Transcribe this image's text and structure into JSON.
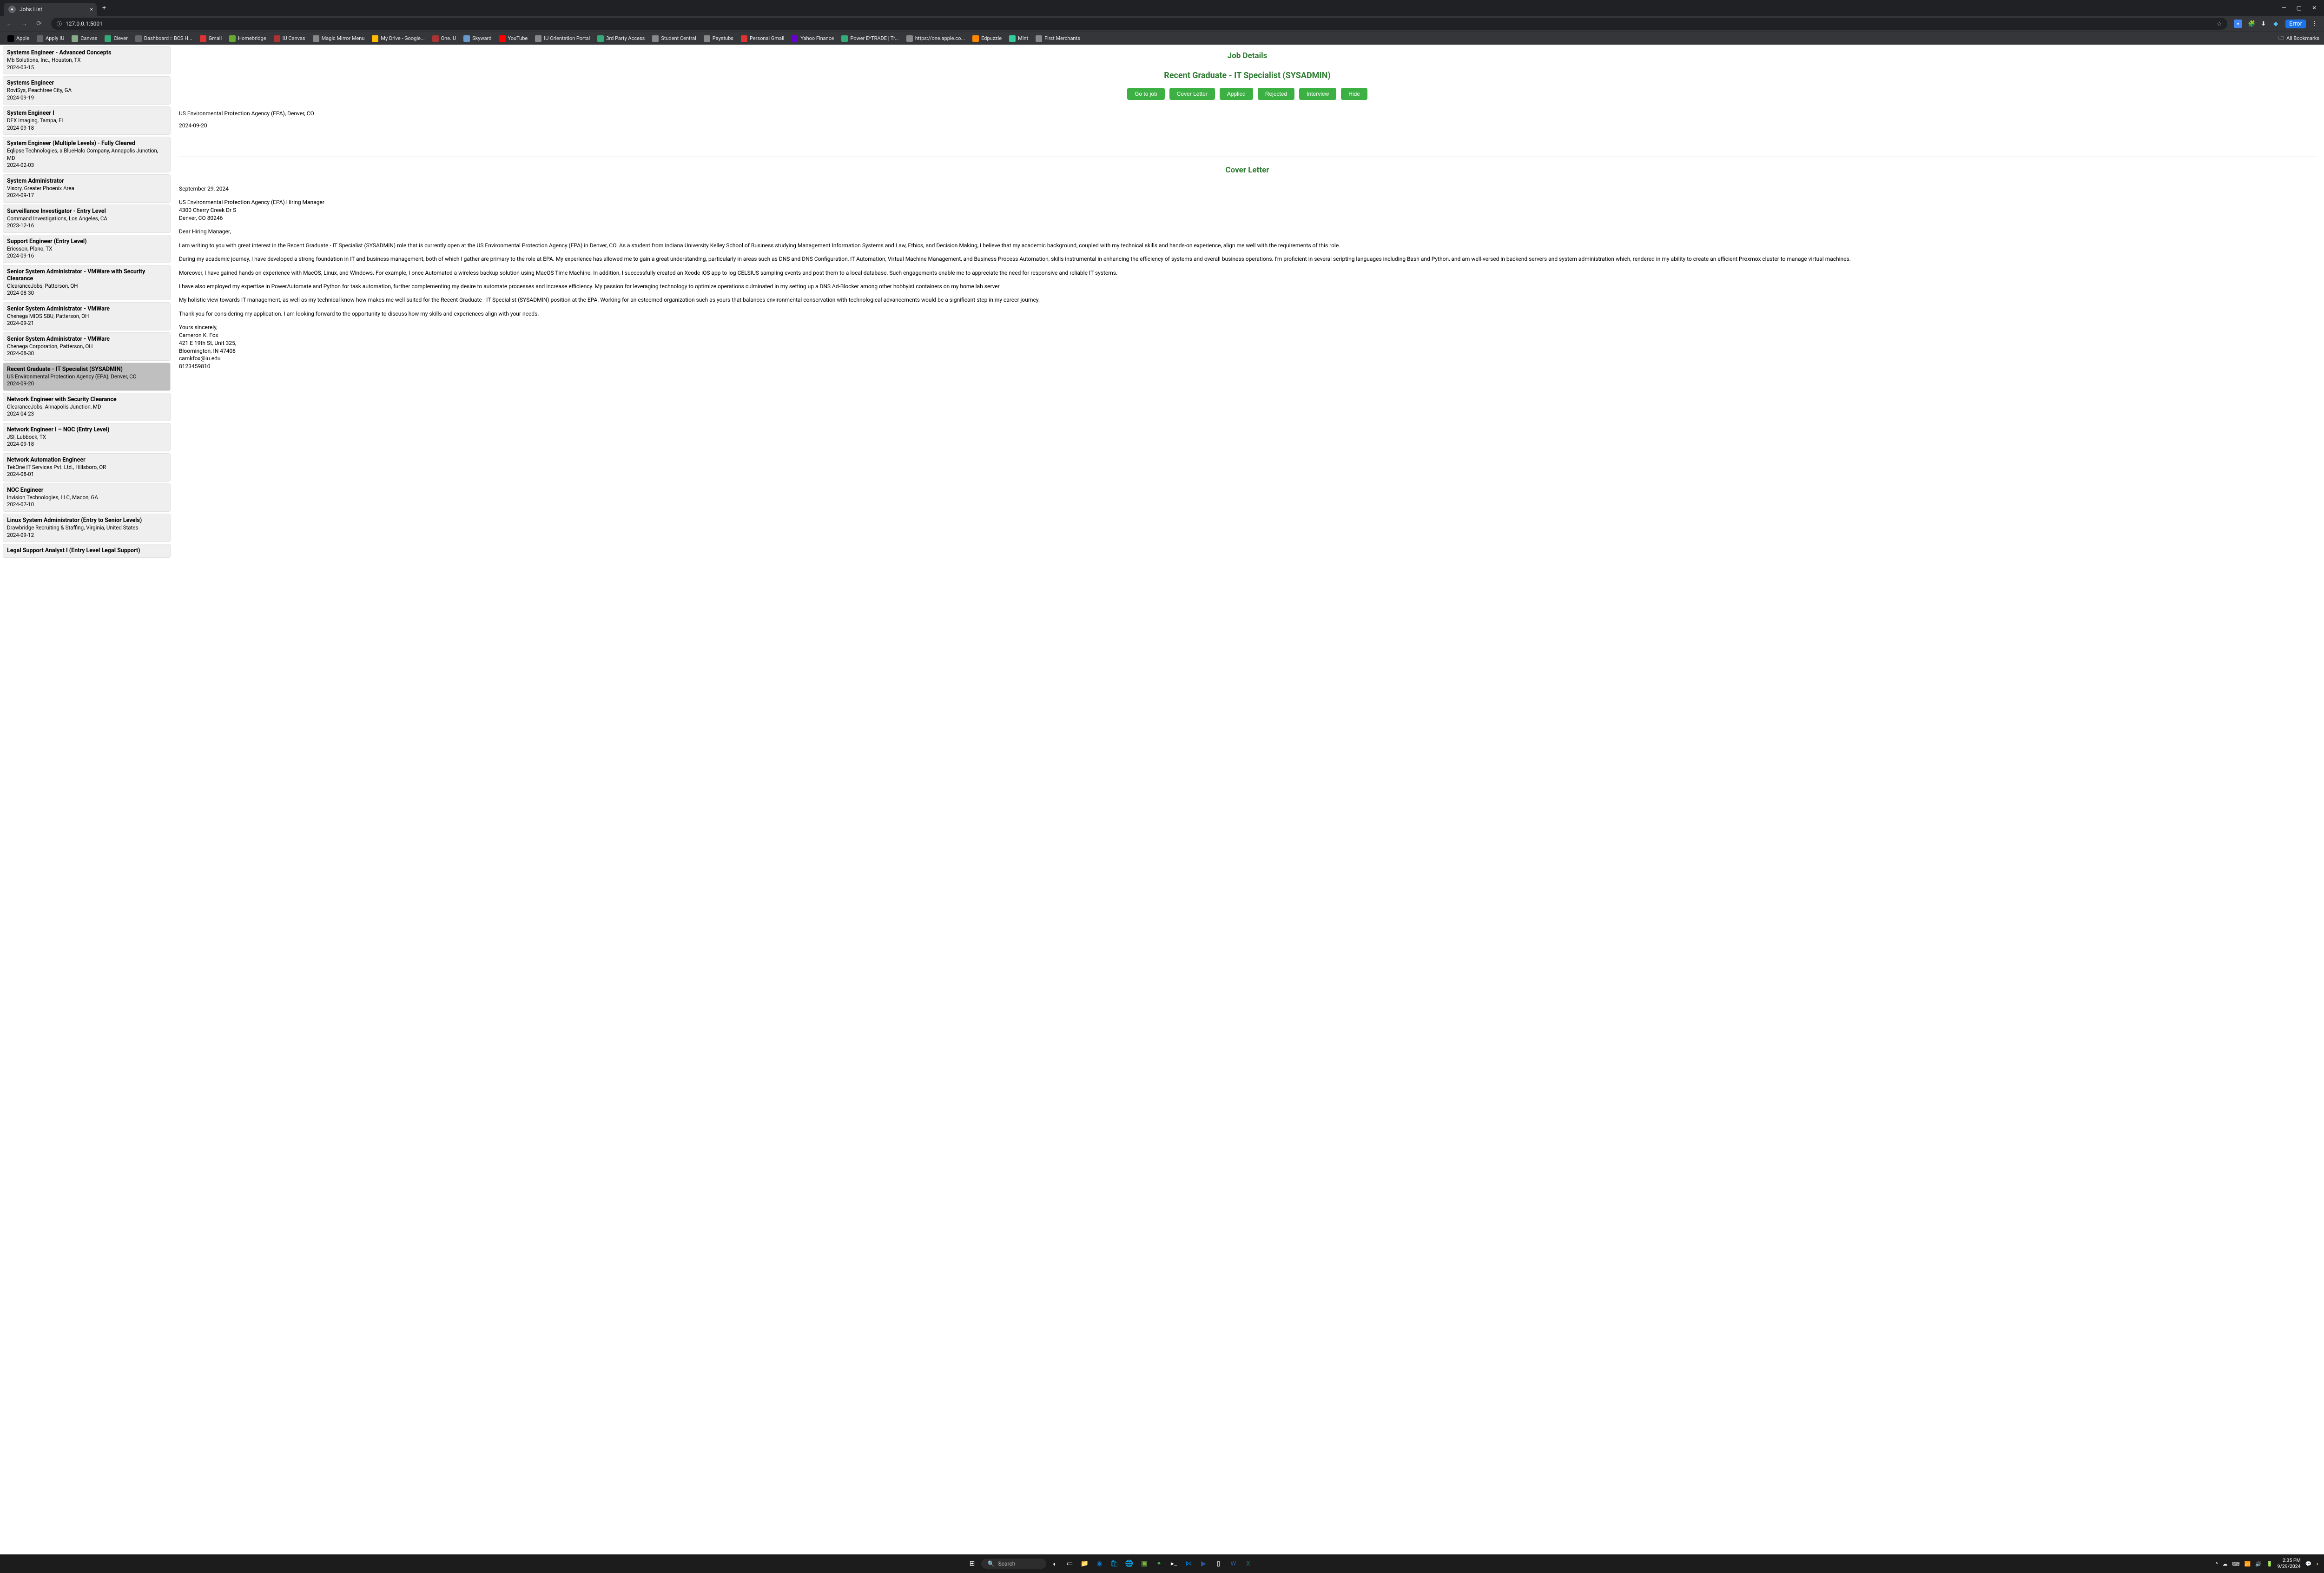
{
  "browser": {
    "tab_title": "Jobs List",
    "url": "127.0.0.1:5001",
    "profile_label": "Error",
    "all_bookmarks": "All Bookmarks"
  },
  "bookmarks": [
    {
      "label": "Apple",
      "color": "#000"
    },
    {
      "label": "Apply IU",
      "color": "#666"
    },
    {
      "label": "Canvas",
      "color": "#8a8"
    },
    {
      "label": "Clever",
      "color": "#3a7"
    },
    {
      "label": "Dashboard :: BCS H...",
      "color": "#666"
    },
    {
      "label": "Gmail",
      "color": "#d33"
    },
    {
      "label": "Homebridge",
      "color": "#6a3"
    },
    {
      "label": "IU Canvas",
      "color": "#a33"
    },
    {
      "label": "Magic Mirror Menu",
      "color": "#888"
    },
    {
      "label": "My Drive - Google...",
      "color": "#fb0"
    },
    {
      "label": "One.IU",
      "color": "#a33"
    },
    {
      "label": "Skyward",
      "color": "#69c"
    },
    {
      "label": "YouTube",
      "color": "#f00"
    },
    {
      "label": "IU Orientation Portal",
      "color": "#888"
    },
    {
      "label": "3rd Party Access",
      "color": "#3a7"
    },
    {
      "label": "Student Central",
      "color": "#888"
    },
    {
      "label": "Paystubs",
      "color": "#888"
    },
    {
      "label": "Personal Gmail",
      "color": "#d33"
    },
    {
      "label": "Yahoo Finance",
      "color": "#60c"
    },
    {
      "label": "Power E*TRADE | Tr...",
      "color": "#3a7"
    },
    {
      "label": "https://one.apple.co...",
      "color": "#888"
    },
    {
      "label": "Edpuzzle",
      "color": "#f80"
    },
    {
      "label": "Mint",
      "color": "#3c9"
    },
    {
      "label": "First Merchants",
      "color": "#888"
    }
  ],
  "jobs": [
    {
      "title": "Systems Engineer - Advanced Concepts",
      "company": "Mb Solutions, Inc., Houston, TX",
      "date": "2024-03-15"
    },
    {
      "title": "Systems Engineer",
      "company": "RoviSys, Peachtree City, GA",
      "date": "2024-09-19"
    },
    {
      "title": "System Engineer I",
      "company": "DEX Imaging, Tampa, FL",
      "date": "2024-09-18"
    },
    {
      "title": "System Engineer (Multiple Levels) - Fully Cleared",
      "company": "Eqlipse Technologies, a BlueHalo Company, Annapolis Junction, MD",
      "date": "2024-02-03"
    },
    {
      "title": "System Administrator",
      "company": "Visory, Greater Phoenix Area",
      "date": "2024-09-17"
    },
    {
      "title": "Surveillance Investigator - Entry Level",
      "company": "Command Investigations, Los Angeles, CA",
      "date": "2023-12-16"
    },
    {
      "title": "Support Engineer (Entry Level)",
      "company": "Ericsson, Plano, TX",
      "date": "2024-09-16"
    },
    {
      "title": "Senior System Administrator - VMWare with Security Clearance",
      "company": "ClearanceJobs, Patterson, OH",
      "date": "2024-08-30"
    },
    {
      "title": "Senior System Administrator - VMWare",
      "company": "Chenega MIOS SBU, Patterson, OH",
      "date": "2024-09-21"
    },
    {
      "title": "Senior System Administrator - VMWare",
      "company": "Chenega Corporation, Patterson, OH",
      "date": "2024-08-30"
    },
    {
      "title": "Recent Graduate - IT Specialist (SYSADMIN)",
      "company": "US Environmental Protection Agency (EPA), Denver, CO",
      "date": "2024-09-20",
      "selected": true
    },
    {
      "title": "Network Engineer with Security Clearance",
      "company": "ClearanceJobs, Annapolis Junction, MD",
      "date": "2024-04-23"
    },
    {
      "title": "Network Engineer I – NOC (Entry Level)",
      "company": "JSI, Lubbock, TX",
      "date": "2024-09-18"
    },
    {
      "title": "Network Automation Engineer",
      "company": "TekOne IT Services Pvt. Ltd., Hillsboro, OR",
      "date": "2024-08-01"
    },
    {
      "title": "NOC Engineer",
      "company": "Invision Technologies, LLC, Macon, GA",
      "date": "2024-07-10"
    },
    {
      "title": "Linux System Administrator (Entry to Senior Levels)",
      "company": "Drawbridge Recruiting & Staffing, Virginia, United States",
      "date": "2024-09-12"
    },
    {
      "title": "Legal Support Analyst I (Entry Level Legal Support)",
      "company": "",
      "date": ""
    }
  ],
  "detail": {
    "heading": "Job Details",
    "title": "Recent Graduate - IT Specialist (SYSADMIN)",
    "actions": {
      "go_to_job": "Go to job",
      "cover_letter": "Cover Letter",
      "applied": "Applied",
      "rejected": "Rejected",
      "interview": "Interview",
      "hide": "Hide"
    },
    "company_loc": "US Environmental Protection Agency (EPA), Denver, CO",
    "date": "2024-09-20"
  },
  "cover": {
    "heading": "Cover Letter",
    "date": "September 29, 2024",
    "addr1": "US Environmental Protection Agency (EPA) Hiring Manager",
    "addr2": "4300 Cherry Creek Dr S",
    "addr3": "Denver, CO 80246",
    "greeting": "Dear Hiring Manager,",
    "p1": "I am writing to you with great interest in the Recent Graduate - IT Specialist (SYSADMIN) role that is currently open at the US Environmental Protection Agency (EPA) in Denver, CO. As a student from Indiana University Kelley School of Business studying Management Information Systems and Law, Ethics, and Decision Making, I believe that my academic background, coupled with my technical skills and hands-on experience, align me well with the requirements of this role.",
    "p2": "During my academic journey, I have developed a strong foundation in IT and business management, both of which I gather are primary to the role at EPA. My experience has allowed me to gain a great understanding, particularly in areas such as DNS and DNS Configuration, IT Automation, Virtual Machine Management, and Business Process Automation, skills instrumental in enhancing the efficiency of systems and overall business operations. I'm proficient in several scripting languages including Bash and Python, and am well-versed in backend servers and system administration which, rendered in my ability to create an efficient Proxmox cluster to manage virtual machines.",
    "p3": "Moreover, I have gained hands on experience with MacOS, Linux, and Windows. For example, I once Automated a wireless backup solution using MacOS Time Machine. In addition, I successfully created an Xcode iOS app to log CELSIUS sampling events and post them to a local database. Such engagements enable me to appreciate the need for responsive and reliable IT systems.",
    "p4": "I have also employed my expertise in PowerAutomate and Python for task automation, further complementing my desire to automate processes and increase efficiency. My passion for leveraging technology to optimize operations culminated in my setting up a DNS Ad-Blocker among other hobbyist containers on my home lab server.",
    "p5": "My holistic view towards IT management, as well as my technical know-how makes me well-suited for the Recent Graduate - IT Specialist (SYSADMIN) position at the EPA. Working for an esteemed organization such as yours that balances environmental conservation with technological advancements would be a significant step in my career journey.",
    "p6": "Thank you for considering my application. I am looking forward to the opportunity to discuss how my skills and experiences align with your needs.",
    "sig1": "Yours sincerely,",
    "sig2": "Cameron K. Fox",
    "sig3": "421 E 19th St, Unit 325,",
    "sig4": "Bloomington, IN 47408",
    "sig5": "camkfox@iu.edu",
    "sig6": "8123459810"
  },
  "taskbar": {
    "search_placeholder": "Search",
    "time": "2:35 PM",
    "date": "9/29/2024"
  }
}
